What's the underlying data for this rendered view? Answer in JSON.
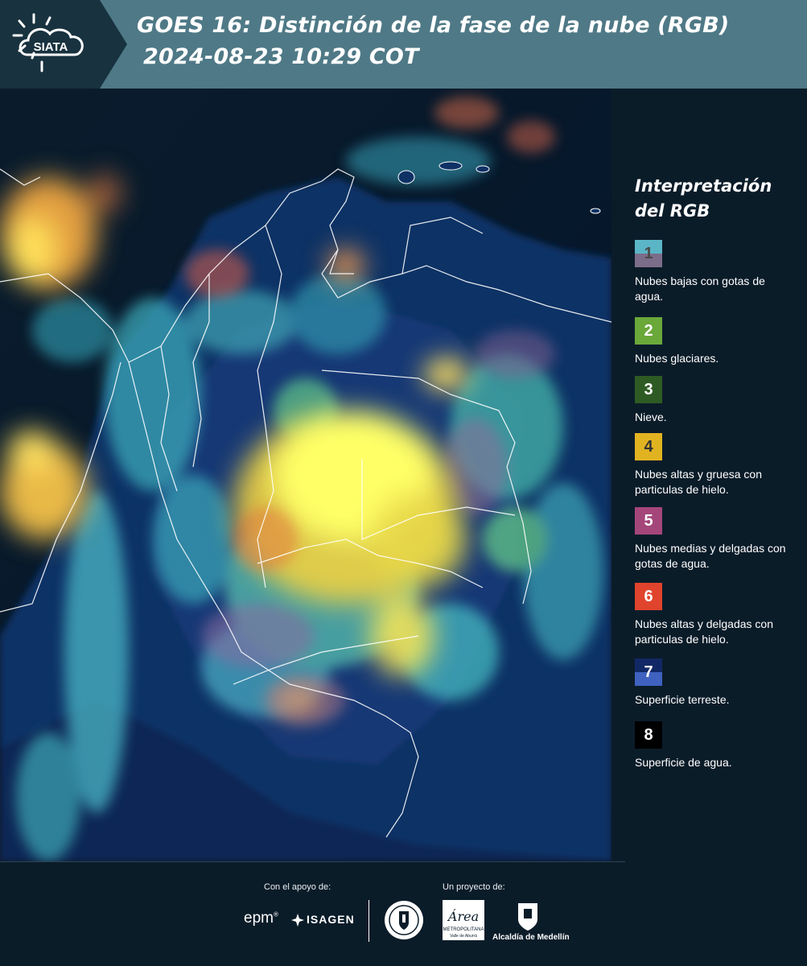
{
  "header": {
    "logo_text": "SIATA",
    "title_line1": "GOES 16: Distinción de la fase de la nube (RGB)",
    "title_line2": "2024-08-23 10:29 COT"
  },
  "legend": {
    "title_line1": "Interpretación",
    "title_line2": "del RGB",
    "items": [
      {
        "num": "1",
        "label": "Nubes bajas con gotas de agua.",
        "color_top": "#5ab6c6",
        "color_bottom": "#7c6d8a",
        "num_color": "#4a4a4a"
      },
      {
        "num": "2",
        "label": "Nubes glaciares.",
        "color_top": "#6aa83a",
        "color_bottom": "#6aa83a",
        "num_color": "#ffffff"
      },
      {
        "num": "3",
        "label": "Nieve.",
        "color_top": "#2e5b23",
        "color_bottom": "#2e5b23",
        "num_color": "#ffffff"
      },
      {
        "num": "4",
        "label": "Nubes altas y gruesa con particulas de hielo.",
        "color_top": "#e2b321",
        "color_bottom": "#e2b321",
        "num_color": "#333333"
      },
      {
        "num": "5",
        "label": "Nubes medias y delgadas con gotas de agua.",
        "color_top": "#a5467a",
        "color_bottom": "#a5467a",
        "num_color": "#ffffff"
      },
      {
        "num": "6",
        "label": "Nubes altas y delgadas con particulas de hielo.",
        "color_top": "#e0442c",
        "color_bottom": "#e0442c",
        "num_color": "#ffffff"
      },
      {
        "num": "7",
        "label": "Superficie terreste.",
        "color_top": "#122866",
        "color_bottom": "#3f62c0",
        "num_color": "#ffffff"
      },
      {
        "num": "8",
        "label": "Superficie de agua.",
        "color_top": "#000000",
        "color_bottom": "#000000",
        "num_color": "#ffffff"
      }
    ]
  },
  "footer": {
    "support_label": "Con el apoyo de:",
    "project_label": "Un proyecto de:",
    "sponsors": [
      "epm",
      "ISAGEN"
    ],
    "partners": [
      "METROPOLITANA",
      "Valle de Aburrá",
      "Alcaldía de Medellín"
    ],
    "area_script": "Área",
    "epm_mark": "®"
  },
  "colors": {
    "header_bg": "#4f7986",
    "panel_bg": "#0b1c29",
    "map_bg": "#06243a"
  }
}
